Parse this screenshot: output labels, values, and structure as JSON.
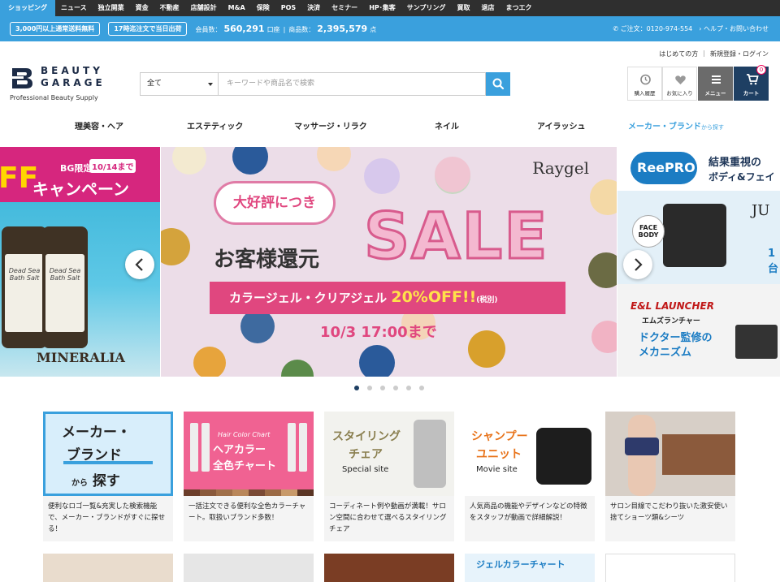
{
  "topnav": {
    "items": [
      {
        "label": "ショッピング",
        "active": true
      },
      {
        "label": "ニュース"
      },
      {
        "label": "独立開業"
      },
      {
        "label": "資金"
      },
      {
        "label": "不動産"
      },
      {
        "label": "店舗設計"
      },
      {
        "label": "M&A"
      },
      {
        "label": "保険"
      },
      {
        "label": "POS"
      },
      {
        "label": "決済"
      },
      {
        "label": "セミナー"
      },
      {
        "label": "HP･集客"
      },
      {
        "label": "サンプリング"
      },
      {
        "label": "買取"
      },
      {
        "label": "退店"
      },
      {
        "label": "まつエク"
      }
    ]
  },
  "infobar": {
    "pill1": "3,000円以上通常送料無料",
    "pill2": "17時迄注文で当日出荷",
    "members_label": "会員数：",
    "members_value": "560,291",
    "members_unit": "口座",
    "products_label": "商品数：",
    "products_value": "2,395,579",
    "products_unit": "点",
    "phone": "ご注文：0120-974-554",
    "help": "ヘルプ・お問い合わせ"
  },
  "logo": {
    "line1": "BEAUTY",
    "line2": "GARAGE",
    "tagline": "Professional Beauty Supply"
  },
  "search": {
    "category": "全て",
    "placeholder": "キーワードや商品名で検索"
  },
  "toplinks": {
    "first": "はじめての方",
    "register": "新規登録・ログイン"
  },
  "header_icons": {
    "history": "購入履歴",
    "favorites": "お気に入り",
    "menu": "メニュー",
    "cart": "カート",
    "cart_count": "0"
  },
  "categories": [
    {
      "label": "理美容・ヘア"
    },
    {
      "label": "エステティック"
    },
    {
      "label": "マッサージ・リラク"
    },
    {
      "label": "ネイル"
    },
    {
      "label": "アイラッシュ"
    }
  ],
  "brand_link": {
    "label": "メーカー・ブランド",
    "suffix": "から探す"
  },
  "banners": {
    "left": {
      "tag": "BG限定",
      "date": "10/14まで",
      "campaign": "キャンペーン",
      "off": "FF",
      "jar_label": "Dead Sea Bath Salt",
      "brand": "MINERALIA"
    },
    "main": {
      "brand": "Raygel",
      "bubble": "大好評につき",
      "headline": "お客様還元",
      "sale": "SALE",
      "ribbon": "カラージェル・クリアジェル",
      "discount": "20%OFF!!",
      "tax": "(税別)",
      "until": "10/3 17:00まで"
    },
    "right": {
      "brand": "ReePRO",
      "title1": "結果重視の",
      "title2": "ボディ&フェイ",
      "face_body": "FACE BODY",
      "ju": "JU",
      "one": "1台",
      "launcher": "E&L LAUNCHER",
      "launcher_ja": "エムズランチャー",
      "doctor": "ドクター監修の",
      "mechanism": "メカニズム"
    }
  },
  "carousel": {
    "dots": 6,
    "active_dot": 0
  },
  "cards": [
    {
      "img_line1": "メーカー・",
      "img_line2": "ブランド",
      "img_line3a": "から",
      "img_line3b": "探す",
      "text": "便利なロゴ一覧&充実した検索機能で、メーカー・ブランドがすぐに探せる！"
    },
    {
      "img_line1": "Hair Color Chart",
      "img_line2": "ヘアカラー",
      "img_line3": "全色チャート",
      "text": "一括注文できる便利な全色カラーチャート。取扱いブランド多数！"
    },
    {
      "img_line1": "スタイリング",
      "img_line2": "チェア",
      "img_line3": "Special site",
      "text": "コーディネート例や動画が満載！サロン空間に合わせて選べるスタイリングチェア"
    },
    {
      "img_line1": "シャンプー",
      "img_line2": "ユニット",
      "img_line3": "Movie site",
      "text": "人気商品の機能やデザインなどの特徴をスタッフが動画で詳細解説！"
    },
    {
      "text": "サロン目線でこだわり抜いた激安使い捨てショーツ類&シーツ"
    }
  ],
  "cards2": [
    {
      "label": ""
    },
    {
      "label": ""
    },
    {
      "label": ""
    },
    {
      "label": "ジェルカラーチャート"
    },
    {
      "label": ""
    }
  ],
  "colors": {
    "accent": "#3aa0dd",
    "navy": "#1e3f63",
    "pink": "#e0477f"
  }
}
